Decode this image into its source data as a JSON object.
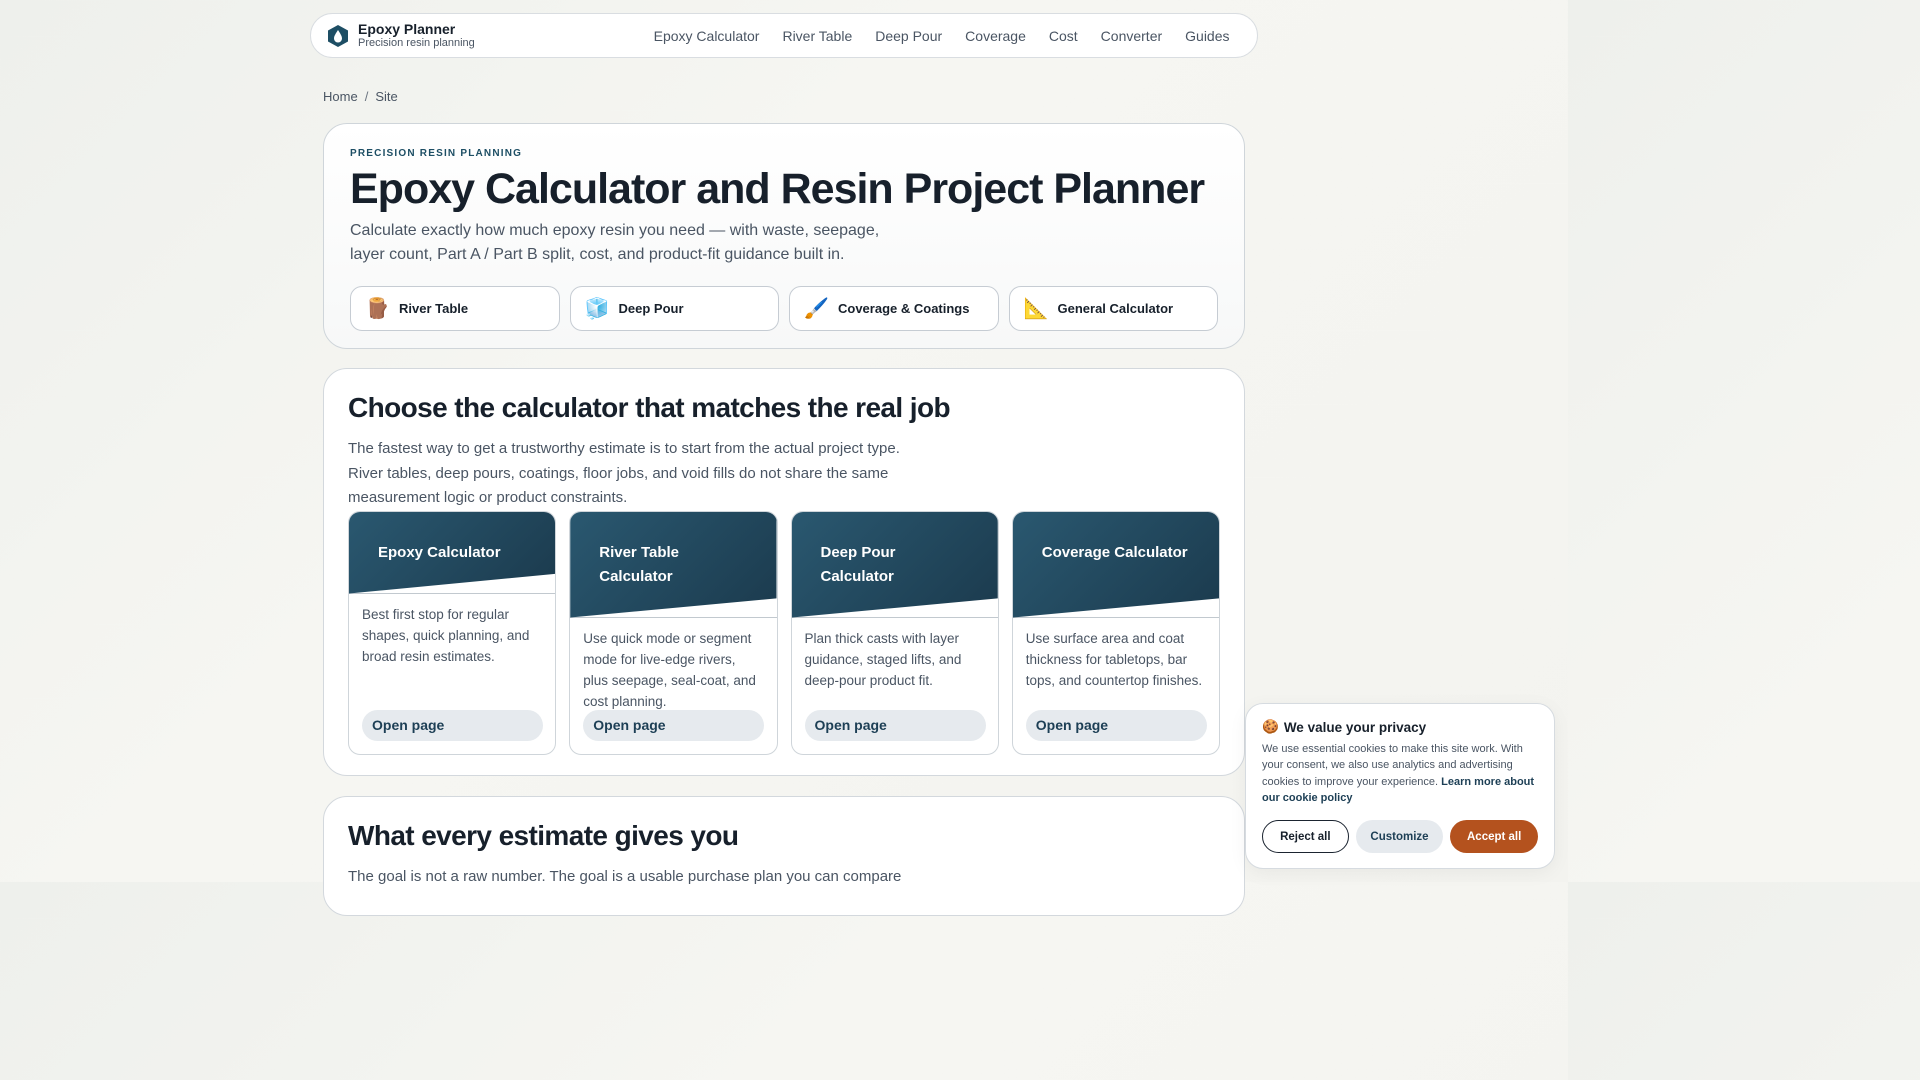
{
  "nav": {
    "brand_name": "Epoxy Planner",
    "brand_sub": "Precision resin planning",
    "links": [
      "Epoxy Calculator",
      "River Table",
      "Deep Pour",
      "Coverage",
      "Cost",
      "Converter",
      "Guides"
    ]
  },
  "breadcrumb": {
    "home": "Home",
    "sep": "/",
    "current": "Site"
  },
  "hero": {
    "eyebrow": "PRECISION RESIN PLANNING",
    "title": "Epoxy Calculator and Resin Project Planner",
    "lead": "Calculate exactly how much epoxy resin you need — with waste, seepage, layer count, Part A / Part B split, cost, and product-fit guidance built in.",
    "quick": [
      {
        "icon": "🪵",
        "label": "River Table"
      },
      {
        "icon": "🧊",
        "label": "Deep Pour"
      },
      {
        "icon": "🖌️",
        "label": "Coverage & Coatings"
      },
      {
        "icon": "📐",
        "label": "General Calculator"
      }
    ]
  },
  "choose": {
    "title": "Choose the calculator that matches the real job",
    "desc": "The fastest way to get a trustworthy estimate is to start from the actual project type. River tables, deep pours, coatings, floor jobs, and void fills do not share the same measurement logic or product constraints.",
    "tools": [
      {
        "title": "Epoxy Calculator",
        "body": "Best first stop for regular shapes, quick planning, and broad resin estimates.",
        "cta": "Open page"
      },
      {
        "title": "River Table Calculator",
        "body": "Use quick mode or segment mode for live-edge rivers, plus seepage, seal-coat, and cost planning.",
        "cta": "Open page"
      },
      {
        "title": "Deep Pour Calculator",
        "body": "Plan thick casts with layer guidance, staged lifts, and deep-pour product fit.",
        "cta": "Open page"
      },
      {
        "title": "Coverage Calculator",
        "body": "Use surface area and coat thickness for tabletops, bar tops, and countertop finishes.",
        "cta": "Open page"
      }
    ]
  },
  "estimate": {
    "title": "What every estimate gives you",
    "desc": "The goal is not a raw number. The goal is a usable purchase plan you can compare"
  },
  "cookie": {
    "icon": "🍪",
    "title": "We value your privacy",
    "text": "We use essential cookies to make this site work. With your consent, we also use analytics and advertising cookies to improve your experience.",
    "link": "Learn more about our cookie policy",
    "reject": "Reject all",
    "customize": "Customize",
    "accept": "Accept all"
  }
}
